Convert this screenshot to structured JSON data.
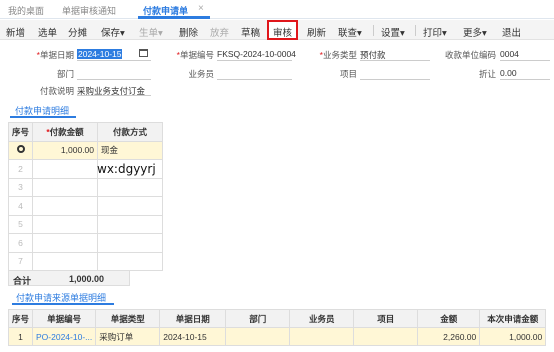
{
  "tabs": [
    {
      "label": "我的桌面"
    },
    {
      "label": "单据审核通知"
    },
    {
      "label": "付款申请单",
      "active": true
    }
  ],
  "tab_close": "×",
  "toolbar": {
    "add": "新增",
    "pick": "选单",
    "split": "分摊",
    "save": "保存",
    "generate": "生单",
    "delete": "删除",
    "abandon": "放弃",
    "draft": "草稿",
    "audit": "审核",
    "refresh": "刷新",
    "linkquery": "联查",
    "settings": "设置",
    "print": "打印",
    "more": "更多",
    "exit": "退出",
    "dropdown_mark": "▾"
  },
  "form": {
    "doc_date": {
      "label": "单据日期",
      "value": "2024-10-15"
    },
    "doc_no": {
      "label": "单据编号",
      "value": "FKSQ-2024-10-0004"
    },
    "biz_type": {
      "label": "业务类型",
      "value": "预付款"
    },
    "payee_code": {
      "label": "收款单位编码",
      "value": "0004"
    },
    "dept": {
      "label": "部门",
      "value": ""
    },
    "staff": {
      "label": "业务员",
      "value": ""
    },
    "project": {
      "label": "项目",
      "value": ""
    },
    "discount": {
      "label": "折让",
      "value": "0.00"
    },
    "remark": {
      "label": "付款说明",
      "value": "采购业务支付订金"
    },
    "required_mark": "*"
  },
  "detail": {
    "title": "付款申请明细",
    "headers": {
      "seq": "序号",
      "amount": "付款金额",
      "method": "付款方式"
    },
    "rows": [
      {
        "seq": "",
        "amount": "1,000.00",
        "method": "现金"
      },
      {
        "seq": "2",
        "amount": "",
        "method": ""
      },
      {
        "seq": "3",
        "amount": "",
        "method": ""
      },
      {
        "seq": "4",
        "amount": "",
        "method": ""
      },
      {
        "seq": "5",
        "amount": "",
        "method": ""
      },
      {
        "seq": "6",
        "amount": "",
        "method": ""
      },
      {
        "seq": "7",
        "amount": "",
        "method": ""
      }
    ],
    "total_label": "合计",
    "total_value": "1,000.00"
  },
  "overlay_text": "wx:dgyyrj",
  "source": {
    "title": "付款申请来源单据明细",
    "headers": [
      "序号",
      "单据编号",
      "单据类型",
      "单据日期",
      "部门",
      "业务员",
      "项目",
      "金额",
      "本次申请金额"
    ],
    "rows": [
      [
        "1",
        "PO-2024-10-...",
        "采购订单",
        "2024-10-15",
        "",
        "",
        "",
        "2,260.00",
        "1,000.00"
      ]
    ]
  }
}
